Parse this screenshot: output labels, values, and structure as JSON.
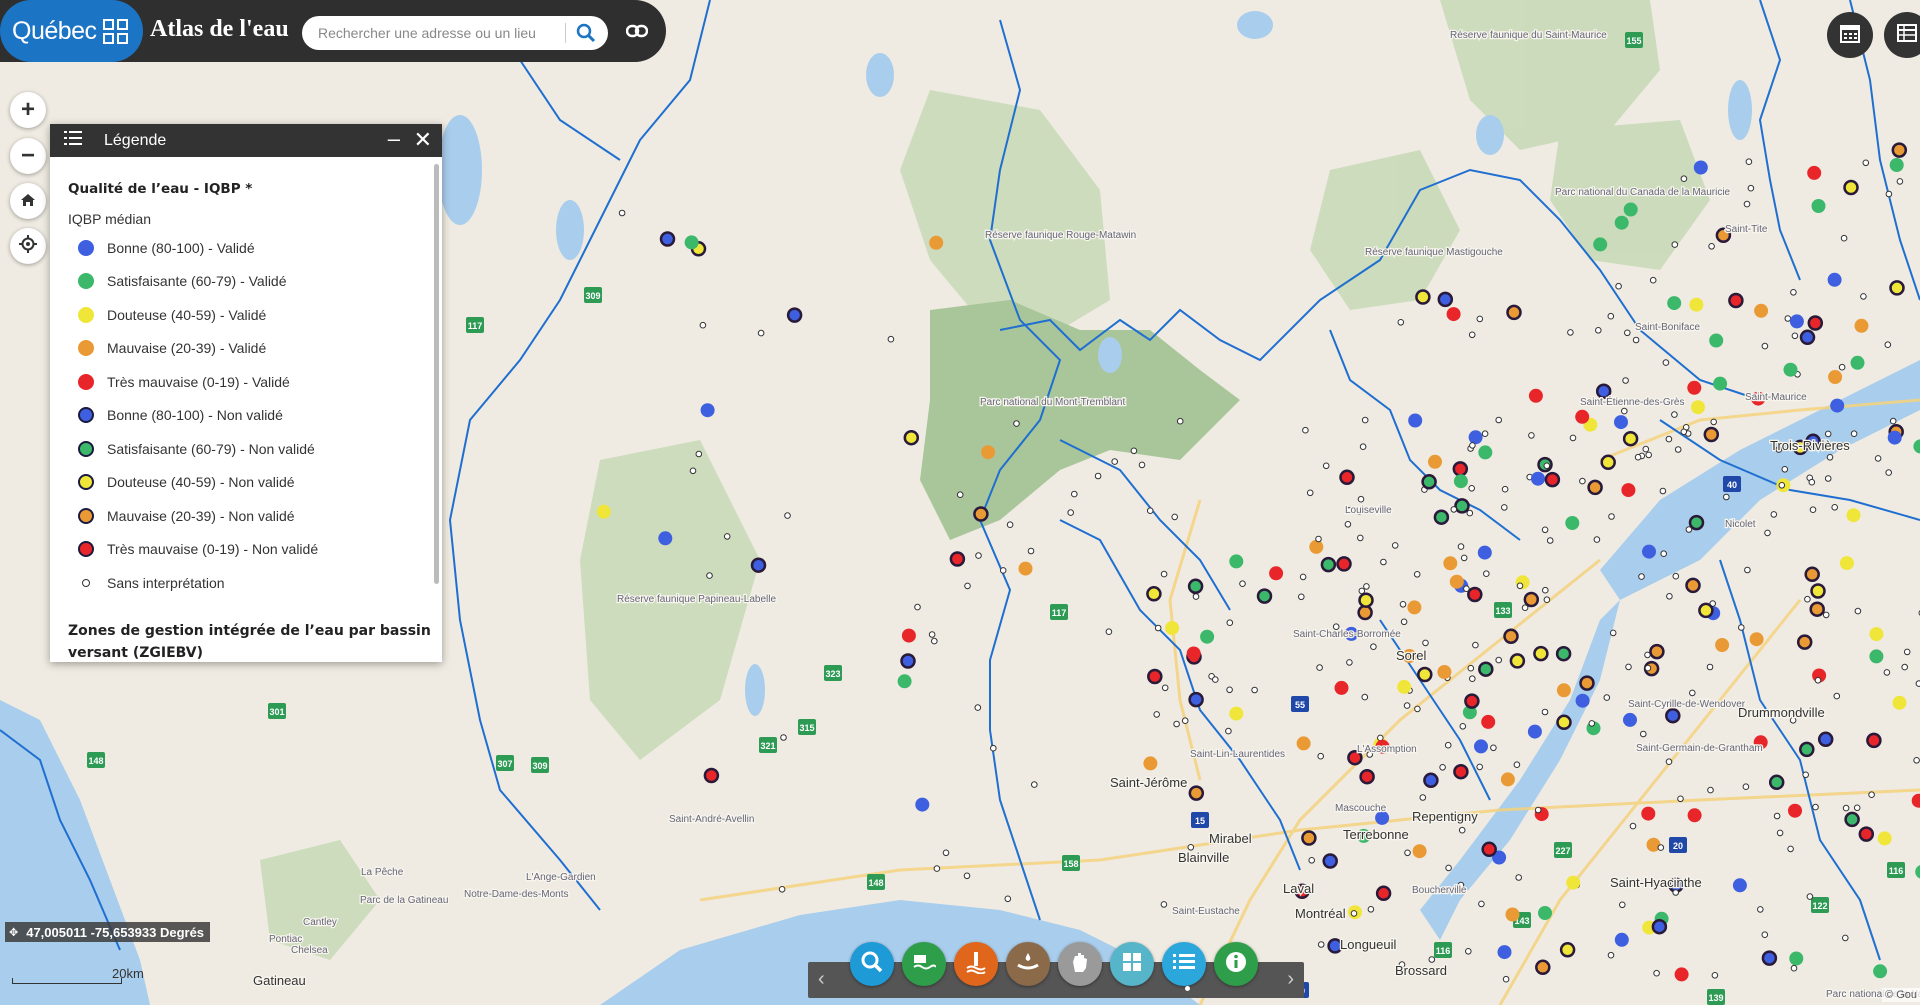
{
  "header": {
    "logo_text": "Québec",
    "app_title": "Atlas de l'eau",
    "search_placeholder": "Rechercher une adresse ou un lieu"
  },
  "controls": [
    "zoom-in",
    "zoom-out",
    "home",
    "locate"
  ],
  "legend": {
    "title": "Légende",
    "section_title": "Qualité de l’eau - IQBP *",
    "subtitle": "IQBP médian",
    "items": [
      {
        "label": "Bonne (80-100) - Validé",
        "color": "#3d5fe0",
        "type": "filled"
      },
      {
        "label": "Satisfaisante (60-79) - Validé",
        "color": "#3cb86a",
        "type": "filled"
      },
      {
        "label": "Douteuse (40-59) - Validé",
        "color": "#f0e63a",
        "type": "filled"
      },
      {
        "label": "Mauvaise (20-39) - Validé",
        "color": "#ea9a35",
        "type": "filled"
      },
      {
        "label": "Très mauvaise (0-19) - Validé",
        "color": "#e8262a",
        "type": "filled"
      },
      {
        "label": "Bonne (80-100) - Non validé",
        "color": "#3d5fe0",
        "type": "outlined"
      },
      {
        "label": "Satisfaisante (60-79) - Non validé",
        "color": "#3cb86a",
        "type": "outlined"
      },
      {
        "label": "Douteuse (40-59) - Non validé",
        "color": "#f0e63a",
        "type": "outlined"
      },
      {
        "label": "Mauvaise (20-39) - Non validé",
        "color": "#ea9a35",
        "type": "outlined"
      },
      {
        "label": "Très mauvaise (0-19) - Non validé",
        "color": "#e8262a",
        "type": "outlined"
      },
      {
        "label": "Sans interprétation",
        "color": "#ffffff",
        "type": "small"
      }
    ],
    "section2_title": "Zones de gestion intégrée de l’eau par bassin versant (ZGIEBV)"
  },
  "map_labels": [
    "Réserve faunique du Saint-Maurice",
    "Réserve faunique Rouge-Matawin",
    "Parc national du Canada de la Mauricie",
    "Réserve faunique Mastigouche",
    "Saint-Tite",
    "Saint-Boniface",
    "Saint-Étienne-des-Grès",
    "Saint-Maurice",
    "Trois-Rivières",
    "Louiseville",
    "Nicolet",
    "Parc national du Mont-Tremblant",
    "Réserve faunique Papineau-Labelle",
    "Saint-Charles-Borromée",
    "Sorel",
    "Saint-Cyrille-de-Wendover",
    "Drummondville",
    "Saint-Germain-de-Grantham",
    "Saint-Lin-Laurentides",
    "L'Assomption",
    "Saint-Jérôme",
    "Mascouche",
    "Repentigny",
    "Mirabel",
    "Terrebonne",
    "Blainville",
    "Saint-André-Avellin",
    "L'Ange-Gardien",
    "Saint-Hyacinthe",
    "La Pêche",
    "Parc de la Gatineau",
    "Notre-Dame-des-Monts",
    "Cantley",
    "Chelsea",
    "Pontiac",
    "Gatineau",
    "Laval",
    "Boucherville",
    "Saint-Eustache",
    "Montréal",
    "Longueuil",
    "Brossard",
    "Parc national de la Yamaska"
  ],
  "route_shields": [
    "155",
    "309",
    "117",
    "323",
    "321",
    "315",
    "301",
    "148",
    "307",
    "309",
    "117",
    "158",
    "148",
    "40",
    "15",
    "20",
    "55",
    "133",
    "116",
    "122",
    "143",
    "139",
    "227",
    "116",
    "30"
  ],
  "coordinates": "47,005011 -75,653933 Degrés",
  "scale_label": "20km",
  "attribution": "© Gou",
  "toolbar_tools": [
    {
      "name": "search-tool",
      "color": "#1e9ad6"
    },
    {
      "name": "station-tool",
      "color": "#2e9e4a"
    },
    {
      "name": "measure-tool",
      "color": "#e0661c"
    },
    {
      "name": "water-tool",
      "color": "#8b6a4a"
    },
    {
      "name": "hand-tool",
      "color": "#9a9a9a"
    },
    {
      "name": "grid-tool",
      "color": "#56b5c9"
    },
    {
      "name": "list-tool",
      "color": "#2ba7db"
    },
    {
      "name": "info-tool",
      "color": "#2e9e4a"
    }
  ]
}
